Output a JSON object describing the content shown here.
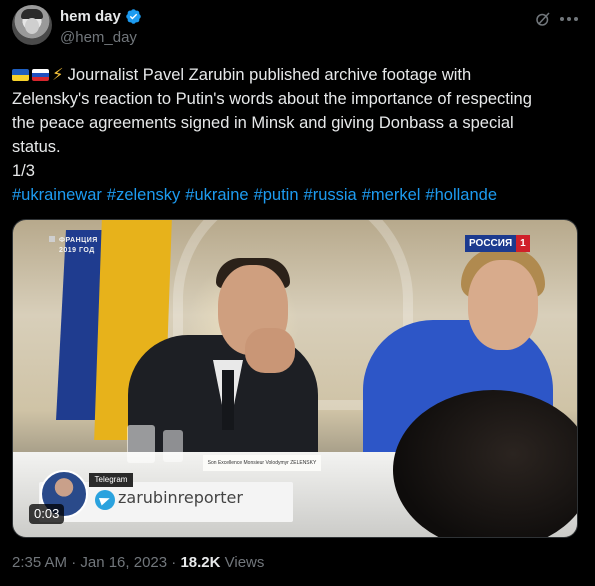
{
  "author": {
    "display_name": "hem day",
    "handle": "@hem_day",
    "verified": true
  },
  "tweet": {
    "lines": [
      "Journalist Pavel Zarubin published archive footage with",
      "Zelensky's reaction to Putin's words about the importance of respecting",
      "the peace agreements signed in Minsk and giving Donbass a special",
      "status.",
      "1/3"
    ],
    "flags": [
      "ukraine-flag",
      "russia-flag",
      "lightning-bolt"
    ],
    "hashtags": [
      "#ukrainewar",
      "#zelensky",
      "#ukraine",
      "#putin",
      "#russia",
      "#merkel",
      "#hollande"
    ]
  },
  "media": {
    "overlay_country": "ФРАНЦИЯ",
    "overlay_year": "2019 ГОД",
    "channel_name": "РОССИЯ",
    "channel_number": "1",
    "telegram_label": "Telegram",
    "telegram_handle": "zarubinreporter",
    "nameplate": "Son Excellence Monsieur Volodymyr ZELENSKY",
    "duration": "0:03"
  },
  "meta": {
    "timestamp": "2:35 AM · Jan 16, 2023 · ",
    "views_count": "18.2K",
    "views_label": "Views"
  },
  "colors": {
    "background": "#000000",
    "text_primary": "#e7e9ea",
    "text_secondary": "#71767b",
    "link": "#1d9bf0",
    "verified": "#1d9bf0"
  },
  "icons": [
    "verified-badge-icon",
    "grok-icon",
    "more-icon",
    "telegram-icon"
  ]
}
